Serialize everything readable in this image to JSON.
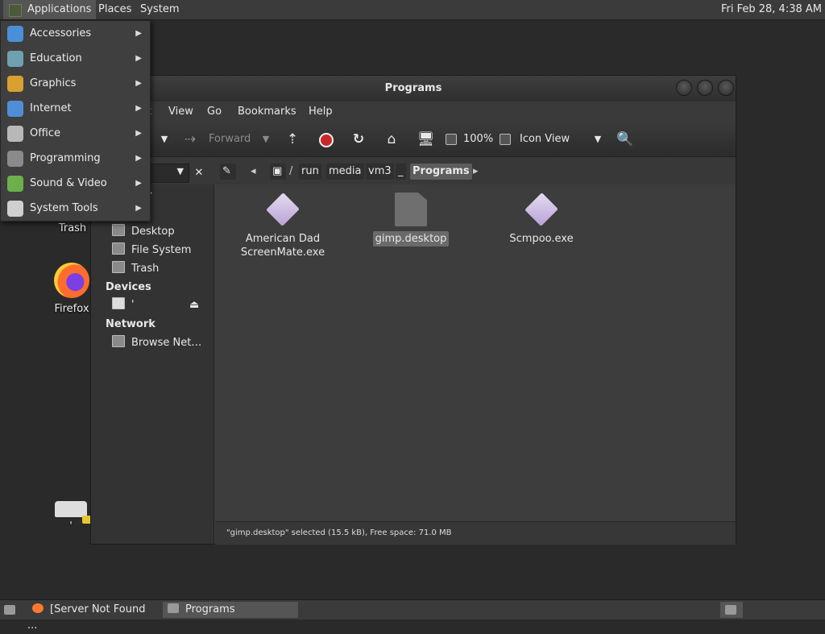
{
  "top_panel": {
    "applications": "Applications",
    "places": "Places",
    "system": "System",
    "clock": "Fri Feb 28,  4:38 AM"
  },
  "app_menu": {
    "items": [
      {
        "label": "Accessories",
        "icon": "accessories-icon",
        "color": "#4a8fd8"
      },
      {
        "label": "Education",
        "icon": "education-icon",
        "color": "#6ea0b0"
      },
      {
        "label": "Graphics",
        "icon": "graphics-icon",
        "color": "#d8a030"
      },
      {
        "label": "Internet",
        "icon": "internet-icon",
        "color": "#4f8ed6"
      },
      {
        "label": "Office",
        "icon": "office-icon",
        "color": "#b8b8b8"
      },
      {
        "label": "Programming",
        "icon": "programming-icon",
        "color": "#8a8a8a"
      },
      {
        "label": "Sound & Video",
        "icon": "sound-video-icon",
        "color": "#6bb04a"
      },
      {
        "label": "System Tools",
        "icon": "system-tools-icon",
        "color": "#cfcfcf"
      }
    ]
  },
  "desktop": {
    "trash": "Trash",
    "firefox": "Firefox",
    "drive": "'"
  },
  "window": {
    "title": "Programs",
    "menu": {
      "edit_partial": "t",
      "view": "View",
      "go": "Go",
      "bookmarks": "Bookmarks",
      "help": "Help"
    },
    "toolbar": {
      "forward": "Forward",
      "zoom": "100%",
      "view_mode": "Icon View"
    },
    "path": {
      "sep": "/",
      "run": "run",
      "media": "media",
      "vm3": "vm3",
      "ellipsis": "_",
      "current": "Programs"
    },
    "sidebar": {
      "partial_1": "er",
      "partial_2": "3",
      "items": [
        {
          "label": "Desktop"
        },
        {
          "label": "File System"
        },
        {
          "label": "Trash"
        }
      ],
      "devices_head": "Devices",
      "device_label": "'",
      "network_head": "Network",
      "network_item": "Browse Net…"
    },
    "files": [
      {
        "name": "American Dad ScreenMate.exe",
        "type": "exe"
      },
      {
        "name": "gimp.desktop",
        "type": "desktop"
      },
      {
        "name": "Scmpoo.exe",
        "type": "exe"
      }
    ],
    "status": "\"gimp.desktop\" selected (15.5 kB), Free space: 71.0 MB"
  },
  "taskbar": {
    "task1": "[Server Not Found ...",
    "task2": "Programs"
  }
}
